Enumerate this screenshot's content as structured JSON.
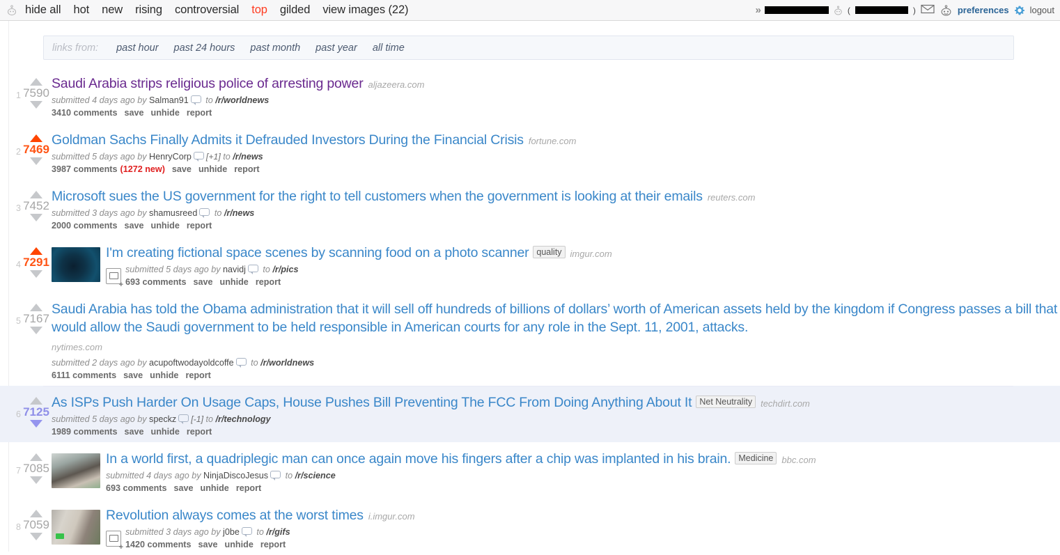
{
  "header": {
    "alien_icon": "reddit-alien-icon",
    "tabs": [
      {
        "label": "hide all",
        "active": false
      },
      {
        "label": "hot",
        "active": false
      },
      {
        "label": "new",
        "active": false
      },
      {
        "label": "rising",
        "active": false
      },
      {
        "label": "controversial",
        "active": false
      },
      {
        "label": "top",
        "active": true
      },
      {
        "label": "gilded",
        "active": false
      },
      {
        "label": "view images (22)",
        "active": false
      }
    ],
    "right": {
      "chevron": "»",
      "username_redacted": "",
      "karma_redacted": "",
      "paren_open": "(",
      "paren_close": ")",
      "mail_icon": "envelope-icon",
      "alien_icon": "reddit-alien-icon",
      "preferences": "preferences",
      "gear_icon": "gear-icon",
      "logout": "logout"
    }
  },
  "links_from": {
    "label": "links from:",
    "options": [
      "past hour",
      "past 24 hours",
      "past month",
      "past year",
      "all time"
    ]
  },
  "posts": [
    {
      "rank": "1",
      "score": "7590",
      "vote": "none",
      "title": "Saudi Arabia strips religious police of arresting power",
      "visited": true,
      "flair": "",
      "domain": "aljazeera.com",
      "domain_block": false,
      "thumb": "",
      "expando": false,
      "submitted": "submitted 4 days ago by",
      "user": "Salman91",
      "delta": "",
      "to": "to",
      "subreddit": "/r/worldnews",
      "comments": "3410 comments",
      "new_comments": "",
      "save": "save",
      "unhide": "unhide",
      "report": "report",
      "highlight": false
    },
    {
      "rank": "2",
      "score": "7469",
      "vote": "up",
      "title": "Goldman Sachs Finally Admits it Defrauded Investors During the Financial Crisis",
      "visited": false,
      "flair": "",
      "domain": "fortune.com",
      "domain_block": false,
      "thumb": "",
      "expando": false,
      "submitted": "submitted 5 days ago by",
      "user": "HenryCorp",
      "delta": "[+1]",
      "to": "to",
      "subreddit": "/r/news",
      "comments": "3987 comments",
      "new_comments": "(1272 new)",
      "save": "save",
      "unhide": "unhide",
      "report": "report",
      "highlight": false
    },
    {
      "rank": "3",
      "score": "7452",
      "vote": "none",
      "title": "Microsoft sues the US government for the right to tell customers when the government is looking at their emails",
      "visited": false,
      "flair": "",
      "domain": "reuters.com",
      "domain_block": false,
      "thumb": "",
      "expando": false,
      "submitted": "submitted 3 days ago by",
      "user": "shamusreed",
      "delta": "",
      "to": "to",
      "subreddit": "/r/news",
      "comments": "2000 comments",
      "new_comments": "",
      "save": "save",
      "unhide": "unhide",
      "report": "report",
      "highlight": false
    },
    {
      "rank": "4",
      "score": "7291",
      "vote": "up",
      "title": "I'm creating fictional space scenes by scanning food on a photo scanner",
      "visited": false,
      "flair": "quality",
      "domain": "imgur.com",
      "domain_block": false,
      "thumb": "space",
      "expando": true,
      "submitted": "submitted 5 days ago by",
      "user": "navidj",
      "delta": "",
      "to": "to",
      "subreddit": "/r/pics",
      "comments": "693 comments",
      "new_comments": "",
      "save": "save",
      "unhide": "unhide",
      "report": "report",
      "highlight": false
    },
    {
      "rank": "5",
      "score": "7167",
      "vote": "none",
      "title": "Saudi Arabia has told the Obama administration that it will sell off hundreds of billions of dollars’ worth of American assets held by the kingdom if Congress passes a bill that would allow the Saudi government to be held responsible in American courts for any role in the Sept. 11, 2001, attacks.",
      "visited": false,
      "flair": "",
      "domain": "nytimes.com",
      "domain_block": true,
      "thumb": "",
      "expando": false,
      "submitted": "submitted 2 days ago by",
      "user": "acupoftwodayoldcoffe",
      "delta": "",
      "to": "to",
      "subreddit": "/r/worldnews",
      "comments": "6111 comments",
      "new_comments": "",
      "save": "save",
      "unhide": "unhide",
      "report": "report",
      "highlight": false
    },
    {
      "rank": "6",
      "score": "7125",
      "vote": "down",
      "title": "As ISPs Push Harder On Usage Caps, House Pushes Bill Preventing The FCC From Doing Anything About It",
      "visited": false,
      "flair": "Net Neutrality",
      "domain": "techdirt.com",
      "domain_block": false,
      "thumb": "",
      "expando": false,
      "submitted": "submitted 5 days ago by",
      "user": "speckz",
      "delta": "[-1]",
      "to": "to",
      "subreddit": "/r/technology",
      "comments": "1989 comments",
      "new_comments": "",
      "save": "save",
      "unhide": "unhide",
      "report": "report",
      "highlight": true
    },
    {
      "rank": "7",
      "score": "7085",
      "vote": "none",
      "title": "In a world first, a quadriplegic man can once again move his fingers after a chip was implanted in his brain.",
      "visited": false,
      "flair": "Medicine",
      "domain": "bbc.com",
      "domain_block": false,
      "thumb": "hands",
      "expando": false,
      "submitted": "submitted 4 days ago by",
      "user": "NinjaDiscoJesus",
      "delta": "",
      "to": "to",
      "subreddit": "/r/science",
      "comments": "693 comments",
      "new_comments": "",
      "save": "save",
      "unhide": "unhide",
      "report": "report",
      "highlight": false
    },
    {
      "rank": "8",
      "score": "7059",
      "vote": "none",
      "title": "Revolution always comes at the worst times",
      "visited": false,
      "flair": "",
      "domain": "i.imgur.com",
      "domain_block": false,
      "thumb": "street",
      "expando": true,
      "submitted": "submitted 3 days ago by",
      "user": "j0be",
      "delta": "",
      "to": "to",
      "subreddit": "/r/gifs",
      "comments": "1420 comments",
      "new_comments": "",
      "save": "save",
      "unhide": "unhide",
      "report": "report",
      "highlight": false
    }
  ]
}
